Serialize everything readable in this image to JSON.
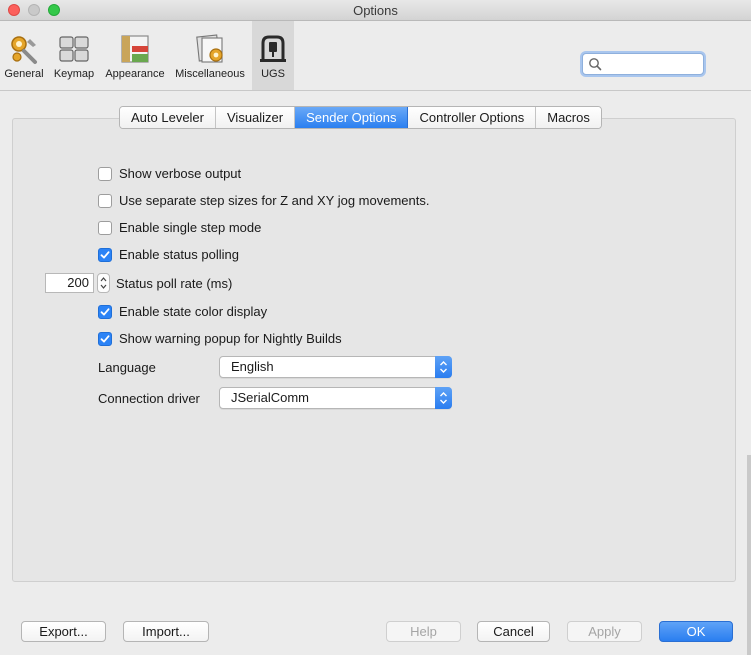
{
  "window": {
    "title": "Options"
  },
  "categories": [
    {
      "label": "General",
      "icon": "gears-icon",
      "selected": false
    },
    {
      "label": "Keymap",
      "icon": "keyboard-icon",
      "selected": false
    },
    {
      "label": "Appearance",
      "icon": "appearance-icon",
      "selected": false
    },
    {
      "label": "Miscellaneous",
      "icon": "miscellaneous-icon",
      "selected": false
    },
    {
      "label": "UGS",
      "icon": "ugs-machine-icon",
      "selected": true
    }
  ],
  "search": {
    "value": "",
    "placeholder": ""
  },
  "tabs": [
    {
      "label": "Auto Leveler",
      "active": false
    },
    {
      "label": "Visualizer",
      "active": false
    },
    {
      "label": "Sender Options",
      "active": true
    },
    {
      "label": "Controller Options",
      "active": false
    },
    {
      "label": "Macros",
      "active": false
    }
  ],
  "options": {
    "verbose_output": {
      "label": "Show verbose output",
      "checked": false
    },
    "separate_step_sizes": {
      "label": "Use separate step sizes for Z and XY jog movements.",
      "checked": false
    },
    "single_step_mode": {
      "label": "Enable single step mode",
      "checked": false
    },
    "status_polling": {
      "label": "Enable status polling",
      "checked": true
    },
    "status_poll_rate": {
      "label": "Status poll rate (ms)",
      "value": "200"
    },
    "state_color_display": {
      "label": "Enable state color display",
      "checked": true
    },
    "nightly_warning": {
      "label": "Show warning popup for Nightly Builds",
      "checked": true
    },
    "language": {
      "label": "Language",
      "value": "English"
    },
    "connection_driver": {
      "label": "Connection driver",
      "value": "JSerialComm"
    }
  },
  "buttons": {
    "export": "Export...",
    "import": "Import...",
    "help": "Help",
    "cancel": "Cancel",
    "apply": "Apply",
    "ok": "OK"
  },
  "colors": {
    "accent": "#2b83f6",
    "close": "#fc605c",
    "zoom": "#34c84a"
  }
}
